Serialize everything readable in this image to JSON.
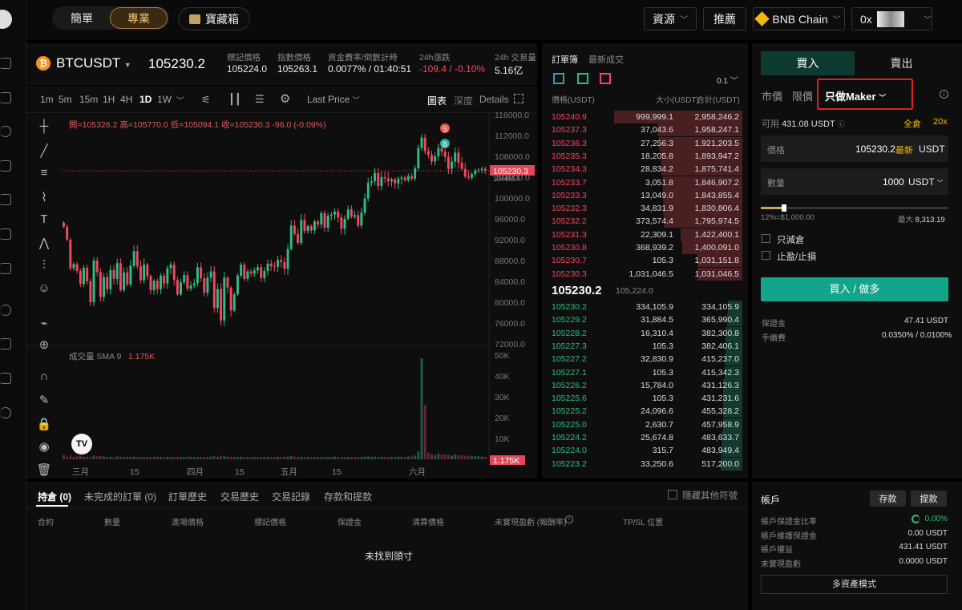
{
  "topbar": {
    "mode_simple": "簡單",
    "mode_pro": "專業",
    "treasure": "寶藏箱",
    "resources": "資源",
    "recommend": "推薦",
    "network": "BNB Chain",
    "wallet": "0x"
  },
  "ticker": {
    "symbol": "BTCUSDT",
    "last": "105230.2",
    "mark_label": "標記價格",
    "mark": "105224.0",
    "index_label": "指數價格",
    "index": "105263.1",
    "funding_label": "資金費率/倒數計時",
    "funding": "0.0077% / 01:40:51",
    "change_label": "24h漲跌",
    "change": "-109.4 / -0.10%",
    "vol_label": "24h 交易量",
    "vol": "5.16亿"
  },
  "chart_toolbar": {
    "intervals": [
      "1m",
      "5m",
      "15m",
      "1H",
      "4H",
      "1D",
      "1W"
    ],
    "active": "1D",
    "price_type": "Last Price",
    "view_chart": "圖表",
    "view_depth": "深度",
    "view_details": "Details"
  },
  "chart": {
    "ohlc": "開=105326.2 高=105770.0 低=105094.1 收=105230.3 -96.0 (-0.09%)",
    "price_tag": "105230.3",
    "price_tag2": "104480.4",
    "s_marker": "S",
    "b_marker": "B",
    "volume_label": "成交量 SMA 9",
    "volume_value": "1.175K",
    "volume_tag": "1.175K"
  },
  "chart_data": {
    "type": "candlestick",
    "price_axis": [
      "116000.0",
      "112000.0",
      "108000.0",
      "104000.0",
      "100000.0",
      "96000.0",
      "92000.0",
      "88000.0",
      "84000.0",
      "80000.0",
      "76000.0",
      "72000.0"
    ],
    "volume_axis": [
      "50K",
      "40K",
      "30K",
      "20K",
      "10K"
    ],
    "x_labels": [
      "三月",
      "15",
      "四月",
      "15",
      "五月",
      "15",
      "六月"
    ],
    "ylim": [
      72000,
      116000
    ],
    "candles_close": [
      94500,
      92000,
      86500,
      87300,
      86000,
      83500,
      86600,
      84000,
      80000,
      88000,
      85800,
      81000,
      84800,
      82500,
      86200,
      84500,
      87500,
      82300,
      85700,
      83400,
      87000,
      89800,
      86900,
      84200,
      87200,
      85000,
      82300,
      84100,
      82500,
      85100,
      83600,
      86500,
      87200,
      84300,
      81500,
      83800,
      85200,
      82600,
      83200,
      83600,
      86700,
      84600,
      81800,
      84700,
      85900,
      78900,
      82500,
      76500,
      84700,
      82800,
      78400,
      81500,
      85100,
      87200,
      84500,
      85900,
      85500,
      86100,
      86700,
      84600,
      86000,
      87400,
      86900,
      86800,
      88100,
      87700,
      86400,
      90200,
      94700,
      93100,
      91400,
      95800,
      93700,
      94600,
      93800,
      95500,
      94900,
      97100,
      94300,
      96600,
      96800,
      97400,
      96300,
      94100,
      96000,
      97800,
      96400,
      96700,
      94700,
      97200,
      99900,
      102900,
      103200,
      104800,
      102300,
      104000,
      103800,
      103200,
      103600,
      102800,
      103700,
      103900,
      103400,
      104200,
      103700,
      105700,
      109600,
      111600,
      109000,
      108300,
      107000,
      108000,
      109600,
      108900,
      107900,
      105600,
      107000,
      108700,
      106800,
      105600,
      104100,
      103900,
      104600,
      105300,
      105400,
      105600,
      105230
    ],
    "volumes_k": [
      2.1,
      1.2,
      2.0,
      1.0,
      1.5,
      1.7,
      1.2,
      1.3,
      1.1,
      1.8,
      1.4,
      1.6,
      1.3,
      1.1,
      1.2,
      1.0,
      1.4,
      1.3,
      1.1,
      1.2,
      1.0,
      1.3,
      1.1,
      1.2,
      1.0,
      1.1,
      1.2,
      1.0,
      1.3,
      1.1,
      1.0,
      1.2,
      1.1,
      1.0,
      1.2,
      1.1,
      1.0,
      1.3,
      1.2,
      1.1,
      1.0,
      1.2,
      1.1,
      1.0,
      1.3,
      1.5,
      1.2,
      1.8,
      1.4,
      1.3,
      1.2,
      1.1,
      1.0,
      1.2,
      1.1,
      1.0,
      1.1,
      1.2,
      1.0,
      1.1,
      1.0,
      1.2,
      1.1,
      1.0,
      1.2,
      1.1,
      1.3,
      1.2,
      1.5,
      1.3,
      1.1,
      1.2,
      1.0,
      1.1,
      1.2,
      1.0,
      1.1,
      1.0,
      1.2,
      1.1,
      1.0,
      1.3,
      1.1,
      1.2,
      1.0,
      1.1,
      1.2,
      1.0,
      1.1,
      1.2,
      1.3,
      1.4,
      1.2,
      1.3,
      1.1,
      1.2,
      1.1,
      1.0,
      1.2,
      1.1,
      1.3,
      1.2,
      1.1,
      1.3,
      1.4,
      1.8,
      3.8,
      48.5,
      26.0,
      3.2,
      2.5,
      2.0,
      2.8,
      2.2,
      2.4,
      2.1,
      1.8,
      2.3,
      2.0,
      1.9,
      1.7,
      1.6,
      1.8,
      1.5,
      1.4,
      1.3,
      1.175
    ]
  },
  "tools": [
    "crosshair",
    "line",
    "hlines",
    "brush",
    "text",
    "pattern",
    "fib",
    "emoji",
    "ruler",
    "zoom",
    "magnet",
    "pencil-lock",
    "lock",
    "eye",
    "trash"
  ],
  "orderbook": {
    "tab_book": "訂單簿",
    "tab_trades": "最新成交",
    "tick": "0.1",
    "h_price": "價格(USDT)",
    "h_size": "大小(USDT)",
    "h_total": "合計(USDT)",
    "mid": "105230.2",
    "mid_sub": "105,224.0",
    "asks": [
      [
        "105240.9",
        "999,999.1",
        "2,958,246.2"
      ],
      [
        "105237.3",
        "37,043.6",
        "1,958,247.1"
      ],
      [
        "105236.3",
        "27,256.3",
        "1,921,203.5"
      ],
      [
        "105235.3",
        "18,205.8",
        "1,893,947.2"
      ],
      [
        "105234.3",
        "28,834.2",
        "1,875,741.4"
      ],
      [
        "105233.7",
        "3,051.8",
        "1,846,907.2"
      ],
      [
        "105233.3",
        "13,049.0",
        "1,843,855.4"
      ],
      [
        "105232.3",
        "34,831.9",
        "1,830,806.4"
      ],
      [
        "105232.2",
        "373,574.4",
        "1,795,974.5"
      ],
      [
        "105231.3",
        "22,309.1",
        "1,422,400.1"
      ],
      [
        "105230.8",
        "368,939.2",
        "1,400,091.0"
      ],
      [
        "105230.7",
        "105.3",
        "1,031,151.8"
      ],
      [
        "105230.3",
        "1,031,046.5",
        "1,031,046.5"
      ]
    ],
    "bids": [
      [
        "105230.2",
        "334,105.9",
        "334,105.9"
      ],
      [
        "105229.2",
        "31,884.5",
        "365,990.4"
      ],
      [
        "105228.2",
        "16,310.4",
        "382,300.8"
      ],
      [
        "105227.3",
        "105.3",
        "382,406.1"
      ],
      [
        "105227.2",
        "32,830.9",
        "415,237.0"
      ],
      [
        "105227.1",
        "105.3",
        "415,342.3"
      ],
      [
        "105226.2",
        "15,784.0",
        "431,126.3"
      ],
      [
        "105225.6",
        "105.3",
        "431,231.6"
      ],
      [
        "105225.2",
        "24,096.6",
        "455,328.2"
      ],
      [
        "105225.0",
        "2,630.7",
        "457,958.9"
      ],
      [
        "105224.2",
        "25,674.8",
        "483,633.7"
      ],
      [
        "105224.0",
        "315.7",
        "483,949.4"
      ],
      [
        "105223.2",
        "33,250.6",
        "517,200.0"
      ]
    ],
    "ask_depth": [
      1.0,
      0.66,
      0.65,
      0.64,
      0.63,
      0.62,
      0.62,
      0.62,
      0.61,
      0.48,
      0.47,
      0.35,
      0.35
    ],
    "bid_depth": [
      0.11,
      0.12,
      0.13,
      0.13,
      0.14,
      0.14,
      0.15,
      0.15,
      0.15,
      0.15,
      0.16,
      0.16,
      0.17
    ]
  },
  "trade": {
    "buy": "買入",
    "sell": "賣出",
    "t_market": "市價",
    "t_limit": "限價",
    "t_maker": "只做Maker",
    "avail_label": "可用",
    "avail": "431.08 USDT",
    "margin_mode": "全倉",
    "leverage": "20x",
    "price_label": "價格",
    "price": "105230.2",
    "price_latest": "最新",
    "unit": "USDT",
    "qty_label": "數量",
    "qty": "1000",
    "slider_left": "12%=$1,000.00",
    "slider_max_label": "最大",
    "slider_max": "8,313.19",
    "reduce_only": "只減倉",
    "tpsl": "止盈/止損",
    "submit": "買入 / 做多",
    "margin_label": "保證金",
    "margin_val": "47.41 USDT",
    "fee_label": "手續費",
    "fee_val": "0.0350% / 0.0100%"
  },
  "positions": {
    "tabs": [
      "持倉 (0)",
      "未完成的訂單 (0)",
      "訂單歷史",
      "交易歷史",
      "交易記錄",
      "存款和提款"
    ],
    "hide_other": "隱藏其他符號",
    "cols": [
      "合約",
      "數量",
      "進場價格",
      "標記價格",
      "保證金",
      "清算價格",
      "未實現盈虧 (報酬率)",
      "TP/SL 位置"
    ],
    "empty": "未找到頭寸"
  },
  "account": {
    "title": "帳戶",
    "deposit": "存款",
    "withdraw": "提款",
    "rows": [
      [
        "帳戶保證金比率",
        "0.00%"
      ],
      [
        "帳戶維護保證金",
        "0.00 USDT"
      ],
      [
        "帳戶權益",
        "431.41 USDT"
      ],
      [
        "未實現盈虧",
        "0.0000 USDT"
      ]
    ],
    "multi": "多資產模式"
  },
  "colors": {
    "up": "#2ebd85",
    "down": "#f6465d",
    "highlight": "#e02020",
    "accent": "#f0b90b"
  }
}
